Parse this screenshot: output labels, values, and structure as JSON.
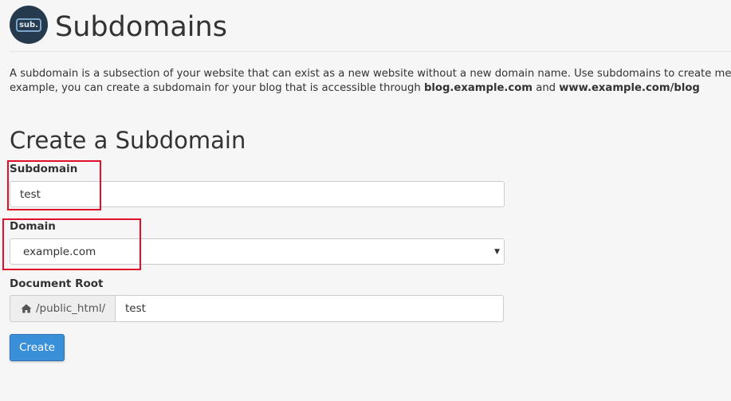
{
  "logo": {
    "text": "sub."
  },
  "header": {
    "title": "Subdomains"
  },
  "description": {
    "line1": "A subdomain is a subsection of your website that can exist as a new website without a new domain name. Use subdomains to create memo",
    "line2_prefix": "example, you can create a subdomain for your blog that is accessible through ",
    "example1": "blog.example.com",
    "line2_mid": " and ",
    "example2": "www.example.com/blog"
  },
  "form": {
    "title": "Create a Subdomain",
    "subdomain": {
      "label": "Subdomain",
      "value": "test"
    },
    "domain": {
      "label": "Domain",
      "value": "example.com",
      "caret": "▼"
    },
    "document_root": {
      "label": "Document Root",
      "prefix": "/public_html/",
      "value": "test",
      "prefix_icon": "home-icon"
    },
    "submit_label": "Create"
  },
  "colors": {
    "accent": "#3a8fd9",
    "highlight": "#e0102b",
    "logo_bg": "#263a4e"
  }
}
